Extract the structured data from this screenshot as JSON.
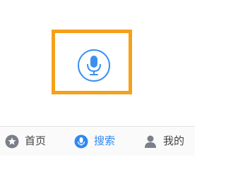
{
  "colors": {
    "highlight": "#f5a01a",
    "accent": "#3c8ff0",
    "tab_active": "#2f88f0",
    "tab_inactive_icon": "#7a7f89",
    "tab_inactive_text": "#444444"
  },
  "main": {
    "voice_button_icon": "microphone-icon"
  },
  "tab_bar": {
    "tabs": [
      {
        "label": "首页",
        "icon": "star-icon",
        "active": false
      },
      {
        "label": "搜索",
        "icon": "microphone-icon",
        "active": true
      },
      {
        "label": "我的",
        "icon": "person-icon",
        "active": false
      }
    ]
  }
}
